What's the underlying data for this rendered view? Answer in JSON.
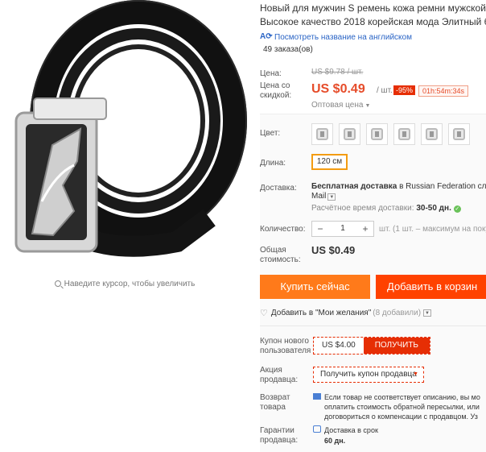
{
  "product": {
    "title_lines": [
      "Новый для мужчин S ремень кожа ремни мужской р",
      "Высокое качество 2018 корейская мода Элитный бр"
    ],
    "translate_link": "Посмотреть название на английском",
    "orders": "49 заказа(ов)",
    "zoom_hint": "Наведите курсор, чтобы увеличить"
  },
  "price": {
    "label": "Цена:",
    "old": "US $9.78 / шт.",
    "sale_label_1": "Цена со",
    "sale_label_2": "скидкой:",
    "new": "US $0.49",
    "per_unit": "/ шт.",
    "discount": "-95%",
    "timer": "01h:54m:34s",
    "wholesale": "Оптовая цена"
  },
  "options": {
    "color_label": "Цвет:",
    "color_swatch_count": 6,
    "length_label": "Длина:",
    "length_value": "120 см"
  },
  "shipping": {
    "label": "Доставка:",
    "line1_bold": "Бесплатная доставка",
    "line1_rest": " в Russian Federation слу",
    "line2": "Mail",
    "time_label": "Расчётное время доставки: ",
    "time_value": "30-50 дн."
  },
  "quantity": {
    "label": "Количество:",
    "minus": "−",
    "value": "1",
    "plus": "+",
    "note": "шт. (1 шт. – максимум на поку"
  },
  "total": {
    "label_1": "Общая",
    "label_2": "стоимость:",
    "value": "US $0.49"
  },
  "actions": {
    "buy_now": "Купить сейчас",
    "add_to_cart": "Добавить в корзин",
    "wishlist": "Добавить в \"Мои желания\"",
    "wishlist_count": "(8 добавили)"
  },
  "promos": {
    "new_user_label_1": "Купон нового",
    "new_user_label_2": "пользователя",
    "coupon_amount": "US $4.00",
    "coupon_get": "ПОЛУЧИТЬ",
    "seller_label_1": "Акция",
    "seller_label_2": "продавца:",
    "seller_select": "Получить купон продавца"
  },
  "returns": {
    "label_1": "Возврат",
    "label_2": "товара",
    "line1": "Если товар не соответствует описанию, вы мо",
    "line2": "оплатить стоимость обратной пересылки, или",
    "line3": "договориться о компенсации с продавцом. Уз"
  },
  "guarantee": {
    "label_1": "Гарантии",
    "label_2": "продавца:",
    "line1": "Доставка в срок",
    "line2": "60 дн."
  },
  "colors": {
    "price_red": "#e64c2a",
    "buy_orange": "#ff7a1a",
    "cart_red": "#ff4200",
    "link_blue": "#2a64c5"
  }
}
